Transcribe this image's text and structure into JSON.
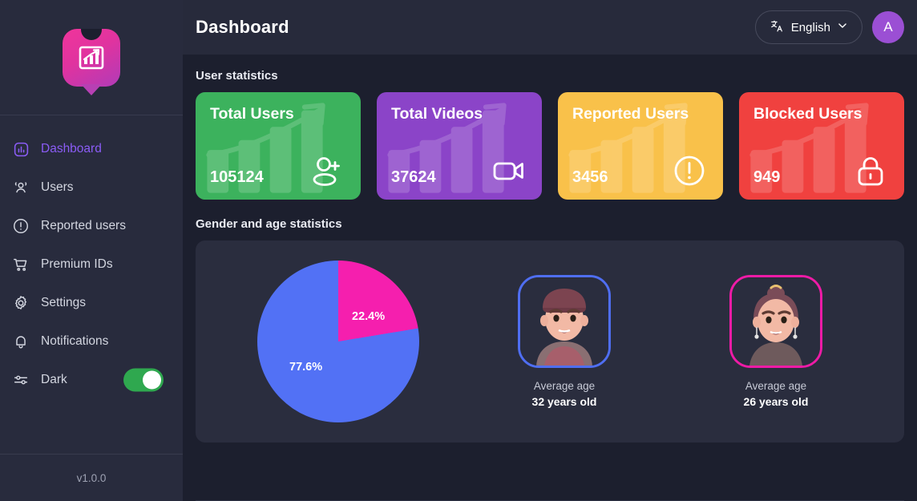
{
  "sidebar": {
    "logo_icon": "chart-bubble-logo-icon",
    "items": [
      {
        "label": "Dashboard",
        "icon": "chart-square-icon",
        "active": true
      },
      {
        "label": "Users",
        "icon": "users-group-icon",
        "active": false
      },
      {
        "label": "Reported users",
        "icon": "alert-circle-icon",
        "active": false
      },
      {
        "label": "Premium IDs",
        "icon": "shopping-cart-icon",
        "active": false
      },
      {
        "label": "Settings",
        "icon": "gear-icon",
        "active": false
      },
      {
        "label": "Notifications",
        "icon": "bell-icon",
        "active": false
      },
      {
        "label": "Dark",
        "icon": "sliders-icon",
        "active": false
      }
    ],
    "dark_toggle_on": true,
    "version": "v1.0.0"
  },
  "header": {
    "title": "Dashboard",
    "language": "English",
    "language_icon": "translate-icon",
    "chevron_icon": "chevron-down-icon",
    "avatar_initial": "A",
    "avatar_color": "#9b4fd4"
  },
  "user_statistics": {
    "section_title": "User statistics",
    "cards": [
      {
        "title": "Total Users",
        "value": "105124",
        "color": "#3cb25d",
        "icon": "user-plus-icon"
      },
      {
        "title": "Total Videos",
        "value": "37624",
        "color": "#8b44c8",
        "icon": "video-camera-icon"
      },
      {
        "title": "Reported Users",
        "value": "3456",
        "color": "#f9c14a",
        "icon": "exclamation-circle-icon"
      },
      {
        "title": "Blocked Users",
        "value": "949",
        "color": "#f0413f",
        "icon": "lock-icon"
      }
    ]
  },
  "gender_age": {
    "section_title": "Gender and age statistics",
    "male": {
      "caption": "Average age",
      "age": "32 years old",
      "border_color": "#4f6ef2",
      "avatar_icon": "male-avatar-icon"
    },
    "female": {
      "caption": "Average age",
      "age": "26 years old",
      "border_color": "#ee1ba6",
      "avatar_icon": "female-avatar-icon"
    }
  },
  "chart_data": {
    "type": "pie",
    "title": "Gender and age statistics",
    "labels": [
      "Male",
      "Female"
    ],
    "values": [
      77.6,
      22.4
    ],
    "value_labels": [
      "77.6%",
      "22.4%"
    ],
    "colors": [
      "#5271f5",
      "#f51fae"
    ],
    "legend": "none",
    "start_angle_deg": 0,
    "direction": "clockwise"
  }
}
